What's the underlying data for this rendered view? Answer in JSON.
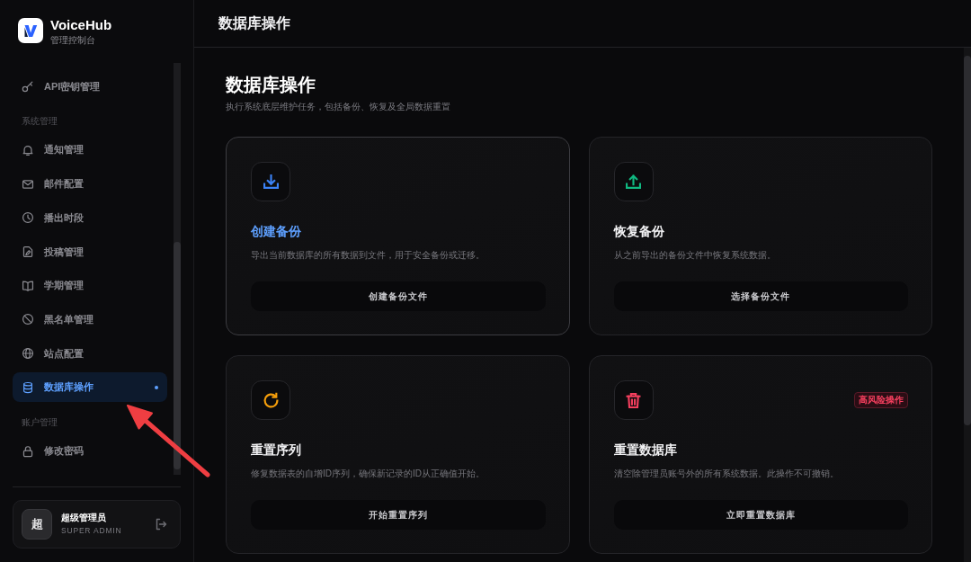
{
  "sidebar": {
    "brand": {
      "name": "VoiceHub",
      "subtitle": "管理控制台"
    },
    "sections": [
      {
        "items": [
          {
            "label": "API密钥管理",
            "selected": false
          }
        ]
      },
      {
        "title": "系统管理",
        "items": [
          {
            "label": "通知管理",
            "selected": false
          },
          {
            "label": "邮件配置",
            "selected": false
          },
          {
            "label": "播出时段",
            "selected": false
          },
          {
            "label": "投稿管理",
            "selected": false
          },
          {
            "label": "学期管理",
            "selected": false
          },
          {
            "label": "黑名单管理",
            "selected": false
          },
          {
            "label": "站点配置",
            "selected": false
          },
          {
            "label": "数据库操作",
            "selected": true
          }
        ]
      },
      {
        "title": "账户管理",
        "items": [
          {
            "label": "修改密码",
            "selected": false
          }
        ]
      }
    ],
    "user": {
      "avatar": "超",
      "name": "超级管理员",
      "role": "SUPER ADMIN"
    }
  },
  "header": {
    "title": "数据库操作"
  },
  "page": {
    "title": "数据库操作",
    "subtitle": "执行系统底层维护任务，包括备份、恢复及全局数据重置"
  },
  "card_rows": [
    {
      "cards": [
        {
          "title": "创建备份",
          "description": "导出当前数据库的所有数据到文件，用于安全备份或迁移。",
          "button": "创建备份文件",
          "color": "#3b82f6",
          "hovered": true
        },
        {
          "title": "恢复备份",
          "description": "从之前导出的备份文件中恢复系统数据。",
          "button": "选择备份文件",
          "color": "#10b981",
          "hovered": false
        }
      ]
    },
    {
      "cards": [
        {
          "title": "重置序列",
          "description": "修复数据表的自增ID序列，确保新记录的ID从正确值开始。",
          "button": "开始重置序列",
          "color": "#f59e0b",
          "hovered": false
        },
        {
          "title": "重置数据库",
          "description": "清空除管理员账号外的所有系统数据。此操作不可撤销。",
          "button": "立即重置数据库",
          "color": "#f43f5e",
          "hovered": false,
          "badge": "高风险操作"
        }
      ]
    }
  ]
}
